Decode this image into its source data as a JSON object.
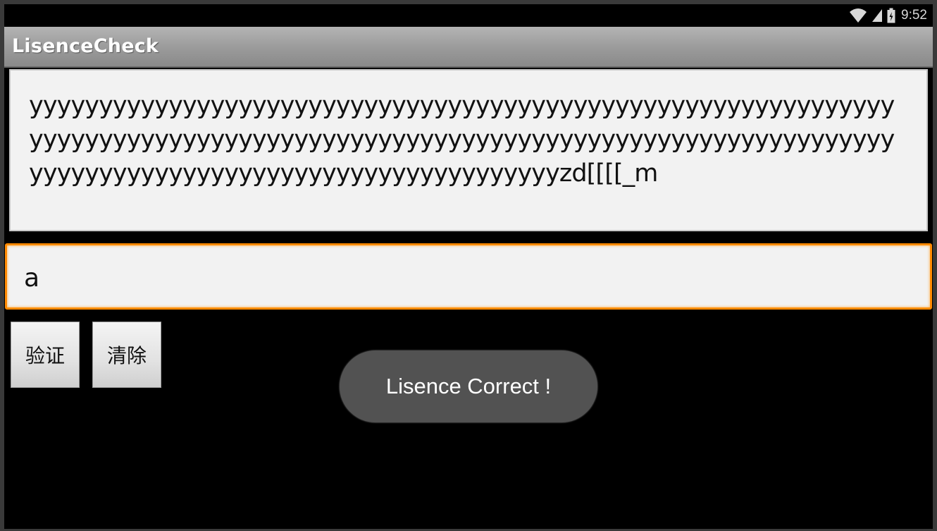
{
  "status_bar": {
    "time": "9:52",
    "icons": [
      "wifi-icon",
      "signal-icon",
      "battery-icon"
    ]
  },
  "action_bar": {
    "title": "LisenceCheck"
  },
  "license_field": {
    "value": "yyyyyyyyyyyyyyyyyyyyyyyyyyyyyyyyyyyyyyyyyyyyyyyyyyyyyyyyyyyyyyyyyyyyyyyyyyyyyyyyyyyyyyyyyyyyyyyyyyyyyyyyyyyyyyyyyyyyyyyyyyyyyyyyyyyyyyyyyyyyyyyyyyyyyyyyyyyyyyyyyyzd[[[[_m"
  },
  "input_field": {
    "value": "a"
  },
  "buttons": {
    "verify_label": "验证",
    "clear_label": "清除"
  },
  "toast": {
    "message": "Lisence Correct !"
  },
  "colors": {
    "accent_focus": "#ff8a00",
    "toast_bg": "#525252"
  }
}
